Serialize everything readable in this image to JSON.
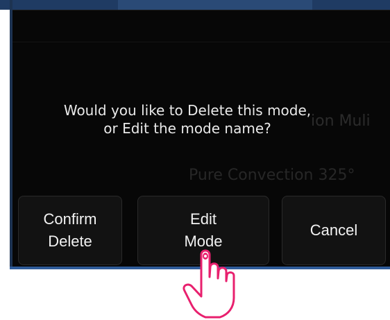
{
  "dialog": {
    "message_line1": "Would you like to Delete this mode,",
    "message_line2": "or Edit the mode name?",
    "background_text_1": "ion Muli",
    "background_text_2": "Pure Convection 325°"
  },
  "buttons": {
    "confirm_line1": "Confirm",
    "confirm_line2": "Delete",
    "edit_line1": "Edit",
    "edit_line2": "Mode",
    "cancel": "Cancel"
  },
  "colors": {
    "screen_bg": "#000000",
    "text": "#e9e9e9",
    "frame_blue": "#2f5c9a",
    "hand_outline": "#e8206e"
  },
  "icons": {
    "pointer": "pointing-hand-icon"
  }
}
